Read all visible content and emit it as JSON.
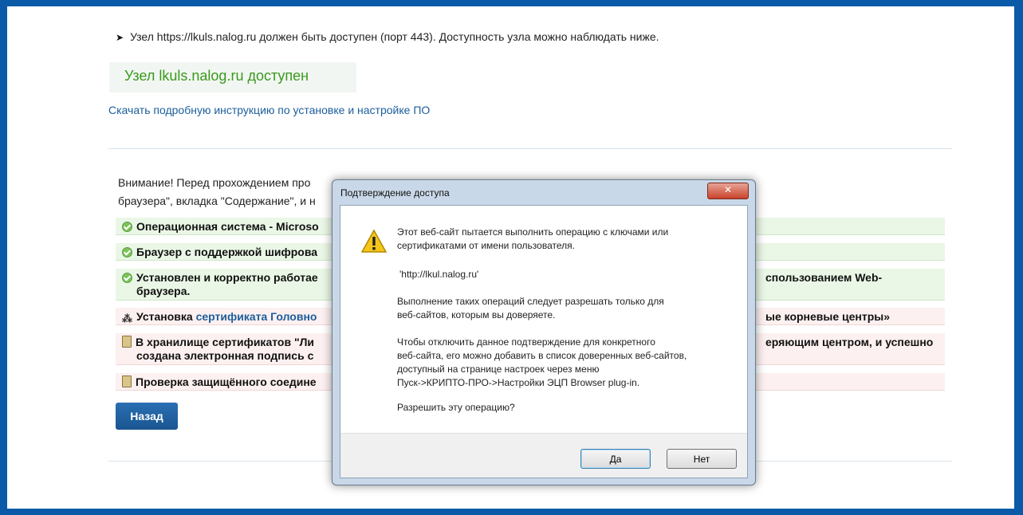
{
  "main": {
    "bullet_text": "Узел https://lkuls.nalog.ru должен быть доступен (порт 443). Доступность узла можно наблюдать ниже.",
    "node_status": "Узел lkuls.nalog.ru доступен",
    "download_link": "Скачать подробную инструкцию по установке и настройке ПО",
    "attention_line1": "Внимание! Перед прохождением про",
    "attention_line2": "браузера\", вкладка \"Содержание\", и н",
    "checks": [
      {
        "text": "Операционная система - Microso",
        "right": "",
        "status": "ok"
      },
      {
        "text": "Браузер с поддержкой шифрова",
        "right": "",
        "status": "ok"
      },
      {
        "text": "Установлен и корректно работае",
        "text2": "браузера.",
        "right": "спользованием Web-",
        "status": "ok"
      },
      {
        "text_prefix": "Установка ",
        "link": "сертификата Головно",
        "right": "ые корневые центры»",
        "status": "pending"
      },
      {
        "text": "В хранилище сертификатов \"Ли",
        "text2": "создана электронная подпись с",
        "right": "еряющим центром, и успешно",
        "status": "waiting"
      },
      {
        "text": "Проверка защищённого соедине",
        "right": "",
        "status": "waiting"
      }
    ],
    "back_button": "Назад"
  },
  "dialog": {
    "title": "Подтверждение доступа",
    "close_label": "✕",
    "message1_line1": "Этот веб-сайт пытается выполнить операцию с ключами или",
    "message1_line2": "сертификатами от имени пользователя.",
    "url": "'http://lkul.nalog.ru'",
    "message2_line1": "Выполнение таких операций следует разрешать только для",
    "message2_line2": "веб-сайтов, которым вы доверяете.",
    "message3_line1": "Чтобы отключить данное подтверждение для конкретного",
    "message3_line2": "веб-сайта, его можно добавить в список доверенных веб-сайтов,",
    "message3_line3": "доступный на странице настроек через меню",
    "message3_line4": "Пуск->КРИПТО-ПРО->Настройки ЭЦП Browser plug-in.",
    "question": "Разрешить эту операцию?",
    "yes_button": "Да",
    "no_button": "Нет"
  }
}
